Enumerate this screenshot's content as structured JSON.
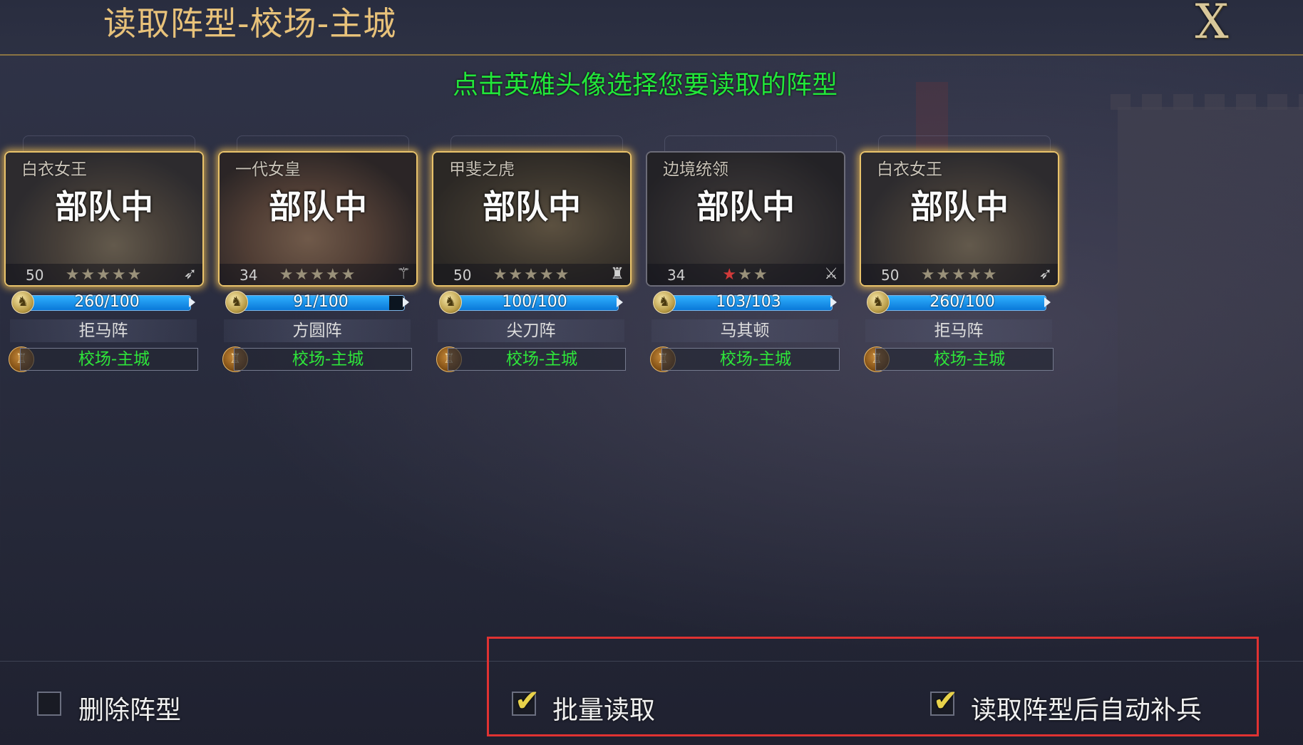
{
  "header": {
    "title": "读取阵型-校场-主城",
    "close_label": "X"
  },
  "hint": "点击英雄头像选择您要读取的阵型",
  "cards": [
    {
      "hero_name": "白衣女王",
      "status": "部队中",
      "level": "50",
      "stars": "★★★★★",
      "class_icon": "bow-icon",
      "troops_text": "260/100",
      "troops_fraction": 1.0,
      "formation": "拒马阵",
      "location": "校场-主城",
      "frame": "gold"
    },
    {
      "hero_name": "一代女皇",
      "status": "部队中",
      "level": "34",
      "stars": "★★★★★",
      "class_icon": "spear-icon",
      "troops_text": "91/100",
      "troops_fraction": 0.91,
      "formation": "方圆阵",
      "location": "校场-主城",
      "frame": "gold"
    },
    {
      "hero_name": "甲斐之虎",
      "status": "部队中",
      "level": "50",
      "stars": "★★★★★",
      "class_icon": "helmet-icon",
      "troops_text": "100/100",
      "troops_fraction": 1.0,
      "formation": "尖刀阵",
      "location": "校场-主城",
      "frame": "gold"
    },
    {
      "hero_name": "边境统领",
      "status": "部队中",
      "level": "34",
      "stars": "★★★",
      "class_icon": "crossed-swords-icon",
      "troops_text": "103/103",
      "troops_fraction": 1.0,
      "formation": "马其顿",
      "location": "校场-主城",
      "frame": "silver"
    },
    {
      "hero_name": "白衣女王",
      "status": "部队中",
      "level": "50",
      "stars": "★★★★★",
      "class_icon": "bow-icon",
      "troops_text": "260/100",
      "troops_fraction": 1.0,
      "formation": "拒马阵",
      "location": "校场-主城",
      "frame": "gold"
    }
  ],
  "footer": {
    "delete": {
      "label": "删除阵型",
      "checked": false
    },
    "batch": {
      "label": "批量读取",
      "checked": true
    },
    "auto_refill": {
      "label": "读取阵型后自动补兵",
      "checked": true
    }
  },
  "colors": {
    "title": "#e8c27a",
    "hint": "#22e63a",
    "location": "#2ee63a",
    "highlight": "#e03232"
  }
}
